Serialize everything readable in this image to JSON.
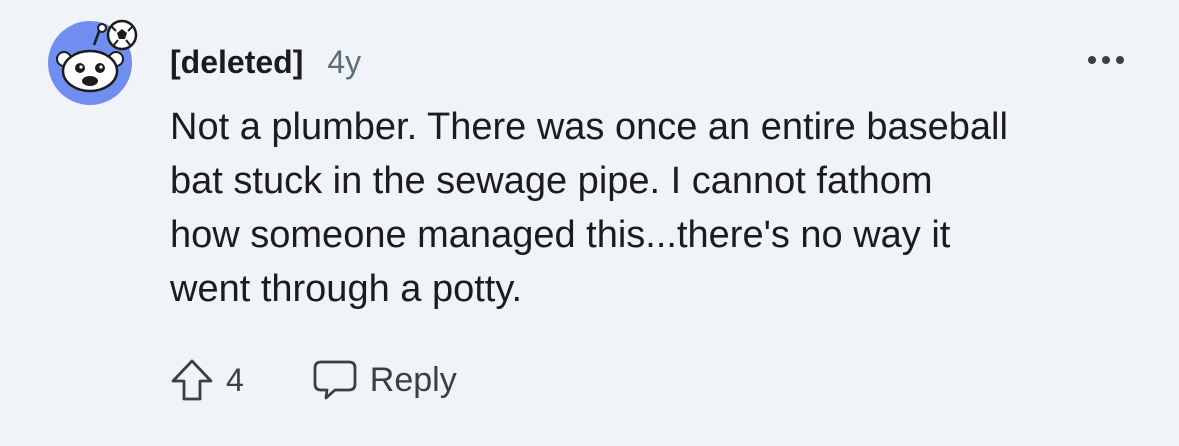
{
  "comment": {
    "author": "[deleted]",
    "age": "4y",
    "body": "Not a plumber. There was once an entire baseball\nbat stuck in the sewage pipe. I cannot fathom\nhow someone managed this...there's no way it\nwent through a potty.",
    "vote_count": "4",
    "reply_label": "Reply"
  },
  "icons": {
    "avatar": "reddit-snoo-avatar-icon",
    "more": "more-options-icon",
    "upvote": "upvote-arrow-icon",
    "reply": "comment-bubble-icon"
  },
  "colors": {
    "background": "#f0f4f9",
    "avatar_bg": "#6f8ef0",
    "muted_text": "#576f76",
    "body_text": "#1c1c1c"
  }
}
